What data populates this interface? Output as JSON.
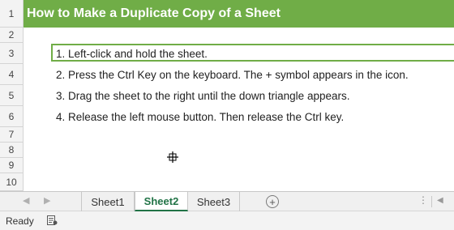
{
  "rows": [
    {
      "num": "1",
      "text": "How to Make a Duplicate Copy of a Sheet"
    },
    {
      "num": "2",
      "text": ""
    },
    {
      "num": "3",
      "text": "1. Left-click and hold the sheet."
    },
    {
      "num": "4",
      "text": "2. Press the Ctrl Key on the keyboard. The + symbol appears in the icon."
    },
    {
      "num": "5",
      "text": "3. Drag the sheet to the right until the down triangle appears."
    },
    {
      "num": "6",
      "text": "4. Release the left mouse button.  Then release the Ctrl key."
    },
    {
      "num": "7",
      "text": ""
    },
    {
      "num": "8",
      "text": ""
    },
    {
      "num": "9",
      "text": ""
    },
    {
      "num": "10",
      "text": ""
    }
  ],
  "tabs": [
    {
      "label": "Sheet1",
      "active": false
    },
    {
      "label": "Sheet2",
      "active": true
    },
    {
      "label": "Sheet3",
      "active": false
    }
  ],
  "status": {
    "ready": "Ready"
  },
  "colors": {
    "title_fill": "#70ad47",
    "active_tab": "#217346"
  },
  "icons": {
    "cursor": "move-copy-cursor-icon",
    "add_sheet": "plus-circle-icon",
    "macro": "macro-record-icon"
  }
}
